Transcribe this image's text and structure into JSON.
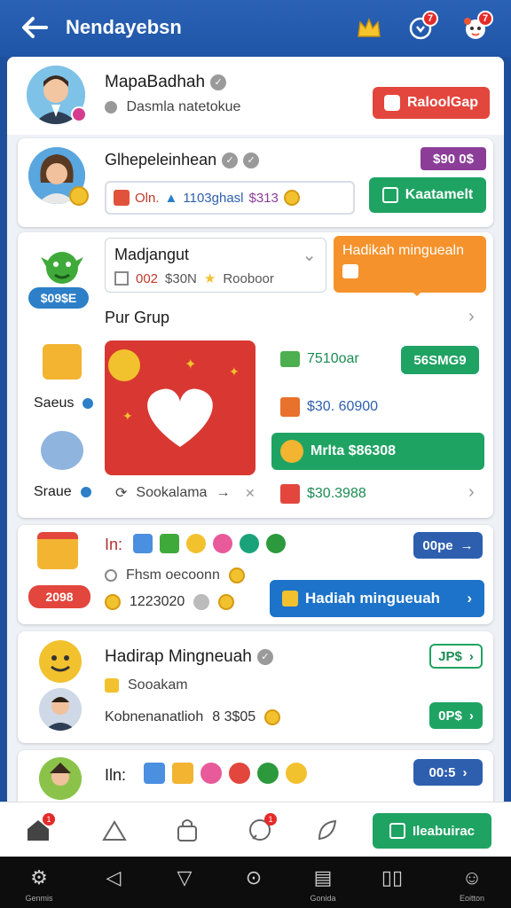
{
  "topbar": {
    "title": "Nendayebsn",
    "badge_1": "7",
    "badge_2": "7"
  },
  "profile": {
    "name": "MapaBadhah",
    "subtitle": "Dasmla natetokue",
    "button": "RaloolGap"
  },
  "card2": {
    "name": "Glhepeleinhean",
    "price_tag": "$90 0$",
    "stats": [
      "Oln.",
      "1103ghasl",
      "$313"
    ],
    "button": "Kaatamelt"
  },
  "card3": {
    "coin_tag": "$09$E",
    "select_title": "Madjangut",
    "select_values": [
      "002",
      "$30N",
      "Rooboor"
    ],
    "tooltip": "Hadikah minguealn",
    "section_title": "Pur Grup",
    "left_items": [
      "Saeus",
      "Sraue"
    ],
    "offers": [
      {
        "amount": "7510oar",
        "button": "56SMG9"
      },
      {
        "amount": "$30. 60900"
      },
      {
        "amount": "Mrlta $86308"
      },
      {
        "amount": "$30.3988"
      }
    ],
    "tile_caption": "Sookalama"
  },
  "card4": {
    "coin_tag": "2098",
    "label": "In:",
    "line_1": "Fhsm oecoonn",
    "line_2": "1223020",
    "top_button": "00pe",
    "main_button": "Hadiah mingueuah"
  },
  "card5": {
    "name": "Hadirap Mingneuah",
    "line_1": "Sooakam",
    "line_2": "Kobnenanatlioh",
    "line_2_value": "8 3$05",
    "button_1": "JP$",
    "button_2": "0P$"
  },
  "card6": {
    "label": "Iln:",
    "button": "00:5"
  },
  "bottom_nav": {
    "badge_home": "1",
    "badge_chat": "1",
    "cta": "Ileabuirac"
  },
  "system_bar": {
    "left_label": "Genmis",
    "center_label": "Gonida",
    "right_label": "Eoitton"
  },
  "colors": {
    "primary": "#1f55a6",
    "green": "#1fa363",
    "red": "#e2463d",
    "orange": "#f5922b",
    "purple": "#8b3d98"
  }
}
